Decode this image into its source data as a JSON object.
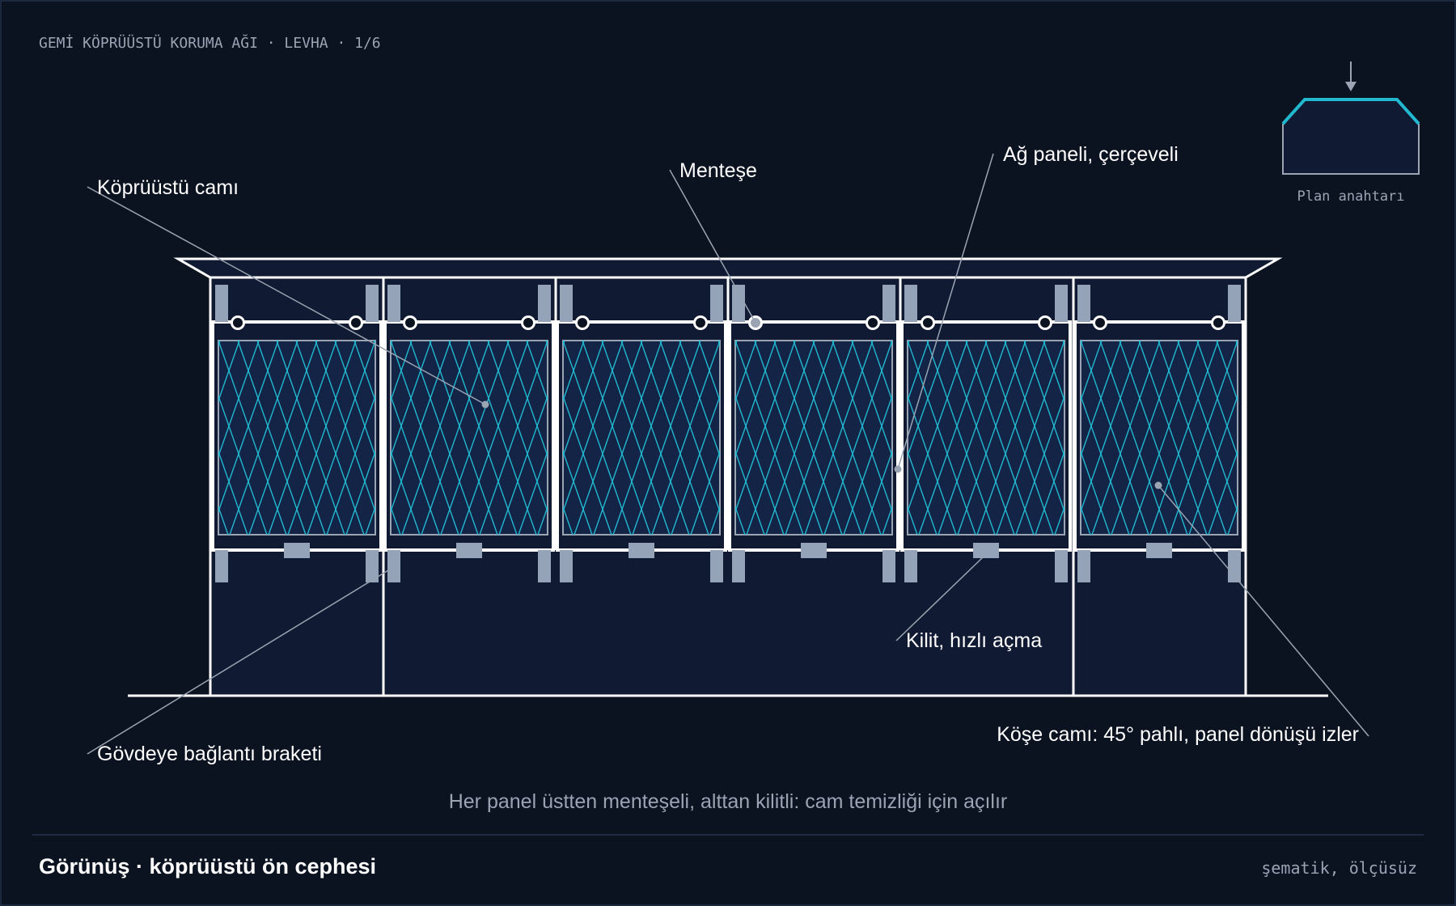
{
  "sheet": {
    "header": "GEMİ KÖPRÜÜSTÜ KORUMA AĞI · LEVHA · 1/6",
    "title": "Görünüş · köprüüstü ön cephesi",
    "scale_note": "şematik, ölçüsüz",
    "caption": "Her panel üstten menteşeli, alttan kilitli: cam temizliği için açılır"
  },
  "plan_key": {
    "label": "Plan anahtarı"
  },
  "callouts": {
    "glass": "Köprüüstü camı",
    "hinge": "Menteşe",
    "mesh_panel": "Ağ paneli, çerçeveli",
    "latch": "Kilit, hızlı açma",
    "bracket": "Gövdeye bağlantı braketi",
    "corner_glass": "Köşe camı: 45° pahlı, panel dönüşü izler"
  },
  "diagram": {
    "panel_count": 6
  },
  "colors": {
    "background": "#0b1220",
    "structure": "#ffffff",
    "mesh": "#22b8cf",
    "hardware": "#94a3b8",
    "leader": "#9aa4b2",
    "fill": "#111a33",
    "text": "#ffffff",
    "muted": "#cbd5e1"
  }
}
